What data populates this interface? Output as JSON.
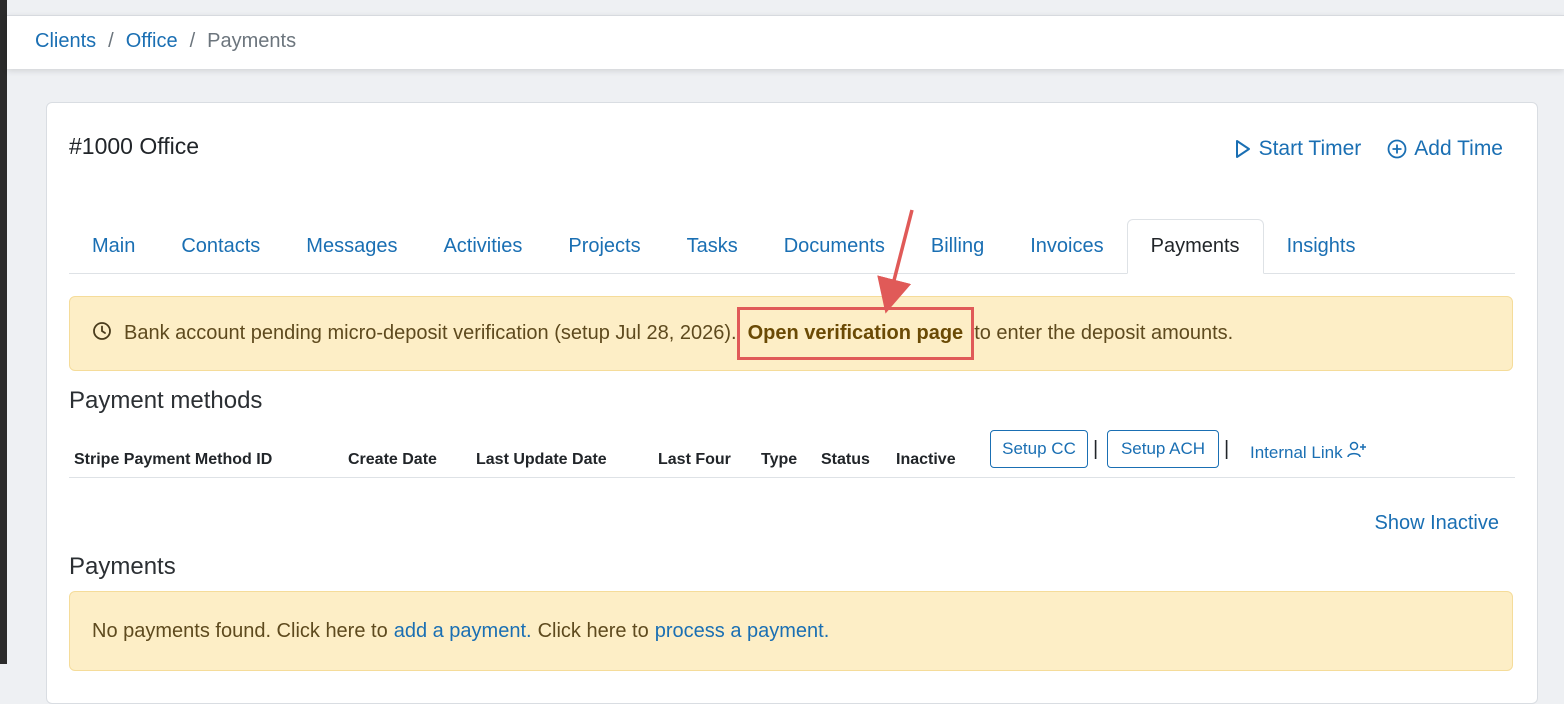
{
  "breadcrumb": {
    "items": [
      "Clients",
      "Office"
    ],
    "current": "Payments",
    "separator": "/"
  },
  "header": {
    "title": "#1000 Office",
    "start_timer": "Start Timer",
    "add_time": "Add Time"
  },
  "tabs": [
    "Main",
    "Contacts",
    "Messages",
    "Activities",
    "Projects",
    "Tasks",
    "Documents",
    "Billing",
    "Invoices",
    "Payments",
    "Insights"
  ],
  "active_tab": "Payments",
  "verify_alert": {
    "text_before": "Bank account pending micro-deposit verification (setup Jul 28, 2026).",
    "link": "Open verification page",
    "text_after": "to enter the deposit amounts."
  },
  "payment_methods": {
    "heading": "Payment methods",
    "columns": [
      "Stripe Payment Method ID",
      "Create Date",
      "Last Update Date",
      "Last Four",
      "Type",
      "Status",
      "Inactive"
    ],
    "setup_cc": "Setup CC",
    "setup_ach": "Setup ACH",
    "pipe": "|",
    "internal_link": "Internal Link"
  },
  "show_inactive": "Show Inactive",
  "payments": {
    "heading": "Payments",
    "text1": "No payments found. Click here to",
    "link1": "add a payment.",
    "text2": "Click here to",
    "link2": "process a payment."
  },
  "colors": {
    "link": "#1a6fb3",
    "alert_bg": "#fdeec6",
    "annotation": "#e05a58"
  }
}
